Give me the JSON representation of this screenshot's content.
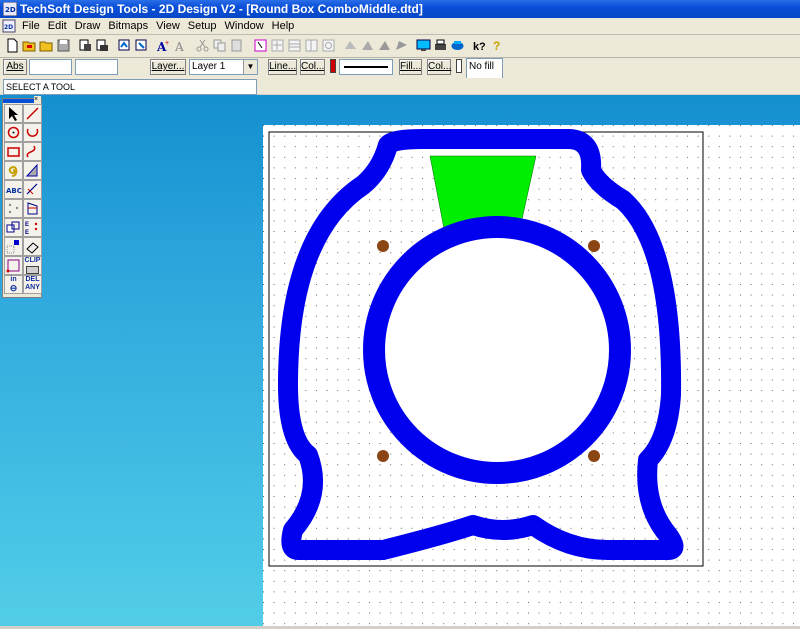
{
  "window": {
    "title": "TechSoft Design Tools - 2D Design V2 - [Round Box ComboMiddle.dtd]"
  },
  "menu": [
    "File",
    "Edit",
    "Draw",
    "Bitmaps",
    "View",
    "Setup",
    "Window",
    "Help"
  ],
  "toolbar_icons": [
    "new-file",
    "open-file",
    "open-folder",
    "save",
    "print-preview",
    "print",
    "import",
    "export",
    "text-insert",
    "text-edit",
    "cut",
    "copy",
    "paste",
    "select-layer",
    "layers",
    "group",
    "ungroup",
    "array",
    "layer-up",
    "layer-down",
    "layer-front",
    "layer-back",
    "display",
    "printer",
    "plotter",
    "help",
    "whats-this"
  ],
  "properties": {
    "abs_label": "Abs",
    "coord_x": "",
    "coord_y": "",
    "layer_button": "Layer...",
    "layer_value": "Layer 1",
    "line_button": "Line...",
    "line_col_button": "Col...",
    "line_color": "#cc0000",
    "fill_button": "Fill...",
    "fill_col_button": "Col...",
    "fill_value": "No fill"
  },
  "status": {
    "prompt": "SELECT A TOOL"
  },
  "palette": {
    "tools": [
      "select-arrow",
      "line",
      "circle",
      "arc",
      "rectangle",
      "curve",
      "spiral",
      "hatch",
      "text",
      "dimension",
      "dots",
      "mirror",
      "copy",
      "grid",
      "node",
      "shape",
      "point",
      "clip",
      "inch",
      "delete"
    ],
    "clip_label": "CLIP",
    "in_label": "in",
    "del_label": "DEL",
    "any_label": "ANY"
  },
  "drawing": {
    "outline_color": "#0000ee",
    "fill_shape_color": "#00ee00",
    "hole_color": "#8b4513",
    "sheet_color": "#ffffff"
  }
}
